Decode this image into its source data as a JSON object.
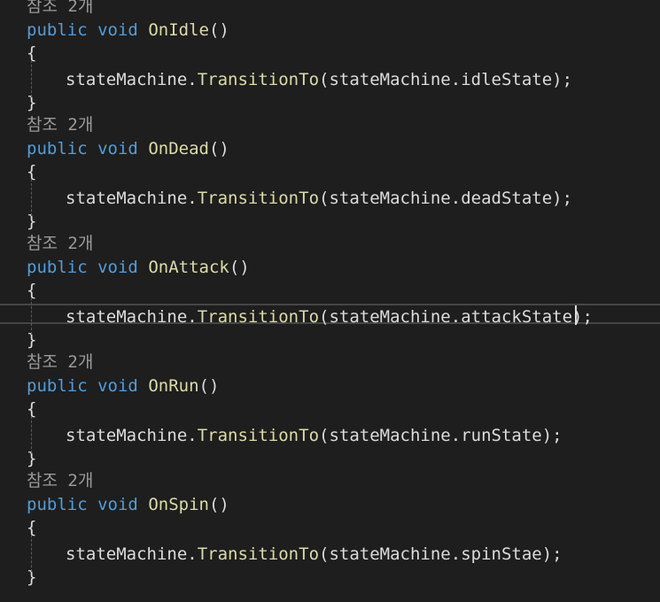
{
  "codelens": "참조 2개",
  "keywords": {
    "public": "public",
    "void": "void"
  },
  "punctuation": {
    "parens": "()",
    "open_brace": "{",
    "close_brace": "}",
    "open_paren": "(",
    "close_stmt": ");",
    "dot": "."
  },
  "identifiers": {
    "state_machine": "stateMachine",
    "transition": "TransitionTo"
  },
  "methods": [
    {
      "name": "OnIdle",
      "state": "idleState"
    },
    {
      "name": "OnDead",
      "state": "deadState"
    },
    {
      "name": "OnAttack",
      "state": "attackState"
    },
    {
      "name": "OnRun",
      "state": "runState"
    },
    {
      "name": "OnSpin",
      "state": "spinStae"
    }
  ]
}
